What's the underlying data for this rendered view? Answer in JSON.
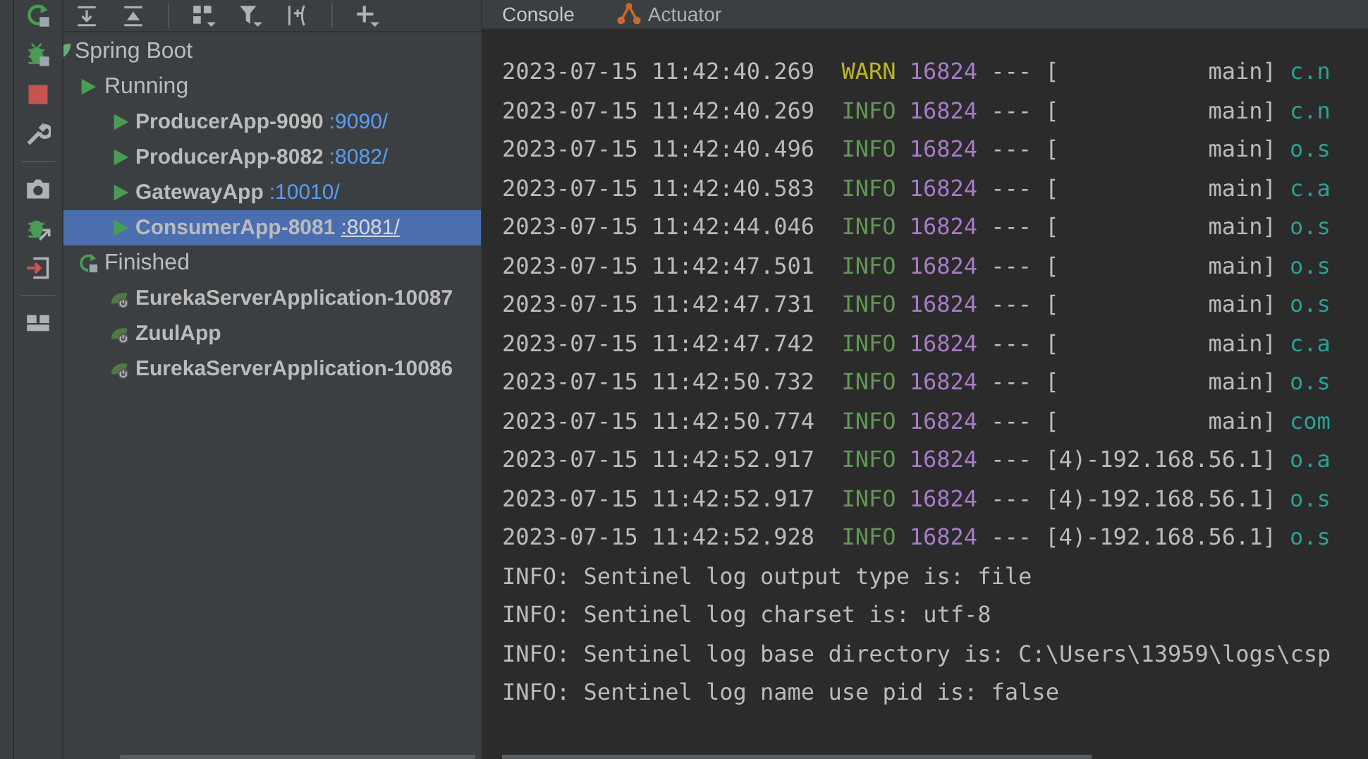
{
  "tree": [
    {
      "label": "Spring Boot",
      "kind": "root",
      "children": [
        {
          "label": "Running",
          "kind": "running",
          "children": [
            {
              "name": "ProducerApp-9090",
              "port": ":9090/",
              "kind": "running_app",
              "selected": false
            },
            {
              "name": "ProducerApp-8082",
              "port": ":8082/",
              "kind": "running_app",
              "selected": false
            },
            {
              "name": "GatewayApp",
              "port": ":10010/",
              "kind": "running_app",
              "selected": false
            },
            {
              "name": "ConsumerApp-8081",
              "port": ":8081/",
              "kind": "running_app",
              "selected": true
            }
          ]
        },
        {
          "label": "Finished",
          "kind": "finished",
          "children": [
            {
              "name": "EurekaServerApplication-10087",
              "kind": "finished_app",
              "selected": false
            },
            {
              "name": "ZuulApp",
              "kind": "finished_app",
              "selected": false
            },
            {
              "name": "EurekaServerApplication-10086",
              "kind": "finished_app",
              "selected": false
            }
          ]
        }
      ]
    }
  ],
  "console": {
    "tabs": [
      {
        "label": "Console",
        "kind": "console",
        "selected": true
      },
      {
        "label": "Actuator",
        "kind": "actuator",
        "selected": false
      }
    ],
    "lines": [
      {
        "kind": "log",
        "timestamp": "2023-07-15 11:42:40.269",
        "level": "WARN",
        "color": "#bbb529",
        "pid": "16824",
        "separator": "---",
        "thread": "[           main]",
        "logger": "c.n"
      },
      {
        "kind": "log",
        "timestamp": "2023-07-15 11:42:40.269",
        "level": "INFO",
        "color": "#629755",
        "pid": "16824",
        "separator": "---",
        "thread": "[           main]",
        "logger": "c.n"
      },
      {
        "kind": "log",
        "timestamp": "2023-07-15 11:42:40.496",
        "level": "INFO",
        "color": "#629755",
        "pid": "16824",
        "separator": "---",
        "thread": "[           main]",
        "logger": "o.s"
      },
      {
        "kind": "log",
        "timestamp": "2023-07-15 11:42:40.583",
        "level": "INFO",
        "color": "#629755",
        "pid": "16824",
        "separator": "---",
        "thread": "[           main]",
        "logger": "c.a"
      },
      {
        "kind": "log",
        "timestamp": "2023-07-15 11:42:44.046",
        "level": "INFO",
        "color": "#629755",
        "pid": "16824",
        "separator": "---",
        "thread": "[           main]",
        "logger": "o.s"
      },
      {
        "kind": "log",
        "timestamp": "2023-07-15 11:42:47.501",
        "level": "INFO",
        "color": "#629755",
        "pid": "16824",
        "separator": "---",
        "thread": "[           main]",
        "logger": "o.s"
      },
      {
        "kind": "log",
        "timestamp": "2023-07-15 11:42:47.731",
        "level": "INFO",
        "color": "#629755",
        "pid": "16824",
        "separator": "---",
        "thread": "[           main]",
        "logger": "o.s"
      },
      {
        "kind": "log",
        "timestamp": "2023-07-15 11:42:47.742",
        "level": "INFO",
        "color": "#629755",
        "pid": "16824",
        "separator": "---",
        "thread": "[           main]",
        "logger": "c.a"
      },
      {
        "kind": "log",
        "timestamp": "2023-07-15 11:42:50.732",
        "level": "INFO",
        "color": "#629755",
        "pid": "16824",
        "separator": "---",
        "thread": "[           main]",
        "logger": "o.s"
      },
      {
        "kind": "log",
        "timestamp": "2023-07-15 11:42:50.774",
        "level": "INFO",
        "color": "#629755",
        "pid": "16824",
        "separator": "---",
        "thread": "[           main]",
        "logger": "com"
      },
      {
        "kind": "log",
        "timestamp": "2023-07-15 11:42:52.917",
        "level": "INFO",
        "color": "#629755",
        "pid": "16824",
        "separator": "---",
        "thread": "[4)-192.168.56.1]",
        "logger": "o.a"
      },
      {
        "kind": "log",
        "timestamp": "2023-07-15 11:42:52.917",
        "level": "INFO",
        "color": "#629755",
        "pid": "16824",
        "separator": "---",
        "thread": "[4)-192.168.56.1]",
        "logger": "o.s"
      },
      {
        "kind": "log",
        "timestamp": "2023-07-15 11:42:52.928",
        "level": "INFO",
        "color": "#629755",
        "pid": "16824",
        "separator": "---",
        "thread": "[4)-192.168.56.1]",
        "logger": "o.s"
      },
      {
        "kind": "plain",
        "text": "INFO: Sentinel log output type is: file"
      },
      {
        "kind": "plain",
        "text": "INFO: Sentinel log charset is: utf-8"
      },
      {
        "kind": "plain",
        "text": "INFO: Sentinel log base directory is: C:\\Users\\13959\\logs\\csp"
      },
      {
        "kind": "plain",
        "text": "INFO: Sentinel log name use pid is: false"
      }
    ]
  }
}
